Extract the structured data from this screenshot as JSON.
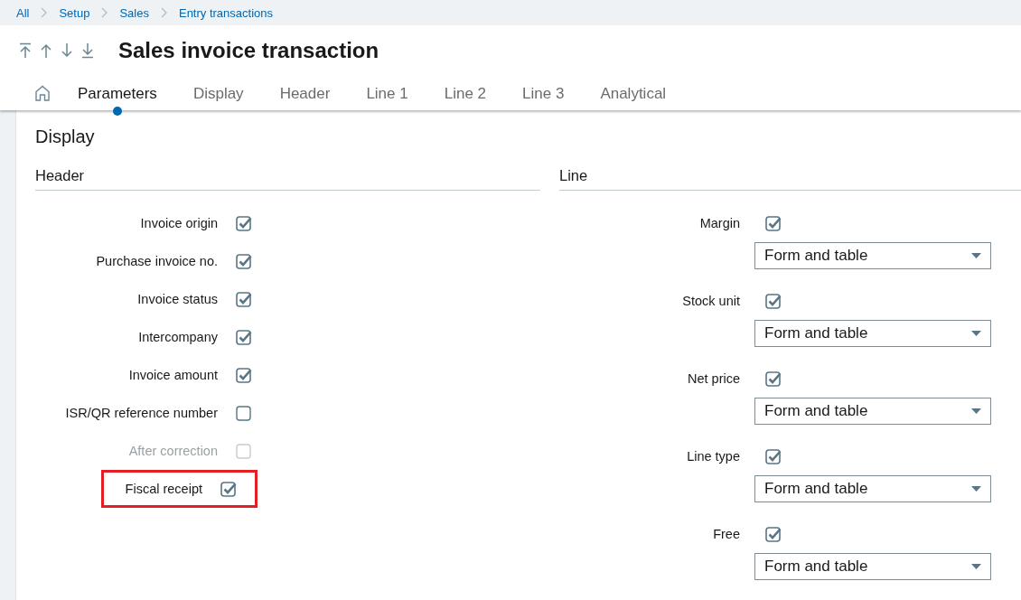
{
  "breadcrumb": [
    {
      "label": "All"
    },
    {
      "label": "Setup"
    },
    {
      "label": "Sales"
    },
    {
      "label": "Entry transactions"
    }
  ],
  "title": "Sales invoice transaction",
  "tabs": [
    {
      "label": "Parameters",
      "selected": true
    },
    {
      "label": "Display",
      "selected": false
    },
    {
      "label": "Header",
      "selected": false
    },
    {
      "label": "Line 1",
      "selected": false
    },
    {
      "label": "Line 2",
      "selected": false
    },
    {
      "label": "Line 3",
      "selected": false
    },
    {
      "label": "Analytical",
      "selected": false
    }
  ],
  "section_title": "Display",
  "header": {
    "title": "Header",
    "fields": [
      {
        "label": "Invoice origin",
        "checked": true,
        "disabled": false,
        "highlighted": false
      },
      {
        "label": "Purchase invoice no.",
        "checked": true,
        "disabled": false,
        "highlighted": false
      },
      {
        "label": "Invoice status",
        "checked": true,
        "disabled": false,
        "highlighted": false
      },
      {
        "label": "Intercompany",
        "checked": true,
        "disabled": false,
        "highlighted": false
      },
      {
        "label": "Invoice amount",
        "checked": true,
        "disabled": false,
        "highlighted": false
      },
      {
        "label": "ISR/QR reference number",
        "checked": false,
        "disabled": false,
        "highlighted": false
      },
      {
        "label": "After correction",
        "checked": false,
        "disabled": true,
        "highlighted": false
      },
      {
        "label": "Fiscal receipt",
        "checked": true,
        "disabled": false,
        "highlighted": true
      }
    ]
  },
  "line": {
    "title": "Line",
    "fields": [
      {
        "label": "Margin",
        "checked": true,
        "display": "Form and table"
      },
      {
        "label": "Stock unit",
        "checked": true,
        "display": "Form and table"
      },
      {
        "label": "Net price",
        "checked": true,
        "display": "Form and table"
      },
      {
        "label": "Line type",
        "checked": true,
        "display": "Form and table"
      },
      {
        "label": "Free",
        "checked": true,
        "display": "Form and table"
      }
    ]
  }
}
